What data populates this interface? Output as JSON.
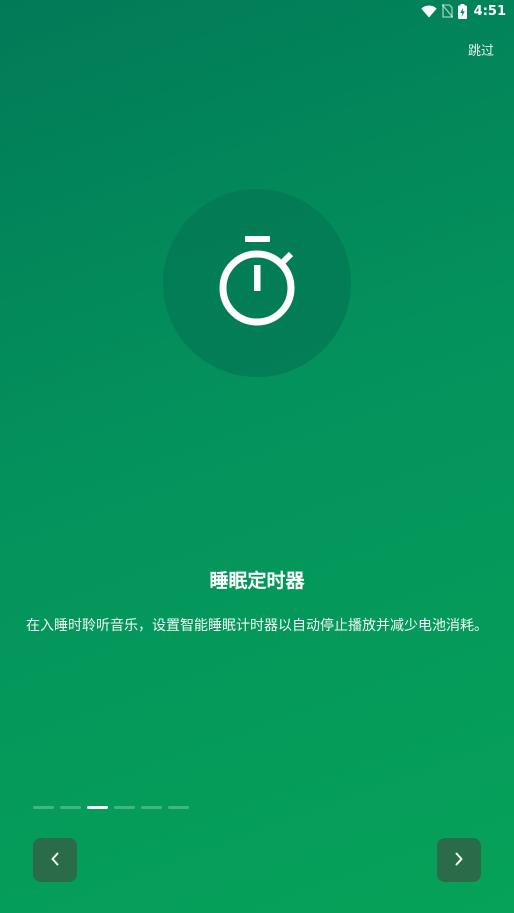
{
  "status_bar": {
    "time": "4:51",
    "icons": [
      "wifi-icon",
      "no-sim-icon",
      "battery-charging-icon"
    ]
  },
  "header": {
    "skip_label": "跳过"
  },
  "hero": {
    "icon": "stopwatch-icon"
  },
  "content": {
    "title": "睡眠定时器",
    "description": "在入睡时聆听音乐，设置智能睡眠计时器以自动停止播放并减少电池消耗。"
  },
  "pager": {
    "total_pages": 6,
    "current_page": 3
  },
  "navigation": {
    "prev_icon": "chevron-left-icon",
    "next_icon": "chevron-right-icon"
  },
  "colors": {
    "gradient_start": "#017a58",
    "gradient_end": "#06a259",
    "circle": "#037a55",
    "nav_button": "#2a6b4a"
  }
}
